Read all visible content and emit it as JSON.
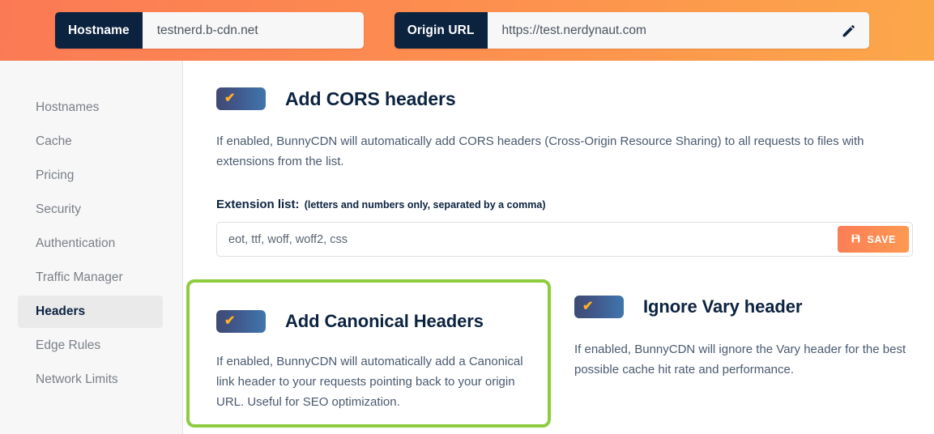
{
  "header": {
    "hostname_label": "Hostname",
    "hostname_value": "testnerd.b-cdn.net",
    "origin_label": "Origin URL",
    "origin_value": "https://test.nerdynaut.com",
    "edit_icon": "pencil-icon",
    "gradient_start": "#fb7a55",
    "gradient_end": "#fca74a"
  },
  "sidebar": {
    "items": [
      {
        "label": "Hostnames",
        "active": false
      },
      {
        "label": "Cache",
        "active": false
      },
      {
        "label": "Pricing",
        "active": false
      },
      {
        "label": "Security",
        "active": false
      },
      {
        "label": "Authentication",
        "active": false
      },
      {
        "label": "Traffic Manager",
        "active": false
      },
      {
        "label": "Headers",
        "active": true
      },
      {
        "label": "Edge Rules",
        "active": false
      },
      {
        "label": "Network Limits",
        "active": false
      }
    ],
    "active_bg": "#eaeaea"
  },
  "cors": {
    "toggle_state": "on",
    "toggle_icon": "checkmark-icon",
    "title": "Add CORS headers",
    "description": "If enabled, BunnyCDN will automatically add CORS headers (Cross-Origin Resource Sharing) to all requests to files with extensions from the list.",
    "extension_label": "Extension list:",
    "extension_hint": "(letters and numbers only, separated by a comma)",
    "extension_value": "eot, ttf, woff, woff2, css",
    "save_label": "SAVE",
    "save_icon": "floppy-disk-icon"
  },
  "canonical": {
    "toggle_state": "on",
    "toggle_icon": "checkmark-icon",
    "title": "Add Canonical Headers",
    "description": "If enabled, BunnyCDN will automatically add a Canonical link header to your requests pointing back to your origin URL. Useful for SEO optimization.",
    "highlight_color": "#8ecc3f"
  },
  "vary": {
    "toggle_state": "on",
    "toggle_icon": "checkmark-icon",
    "title": "Ignore Vary header",
    "description": "If enabled, BunnyCDN will ignore the Vary header for the best possible cache hit rate and performance."
  }
}
